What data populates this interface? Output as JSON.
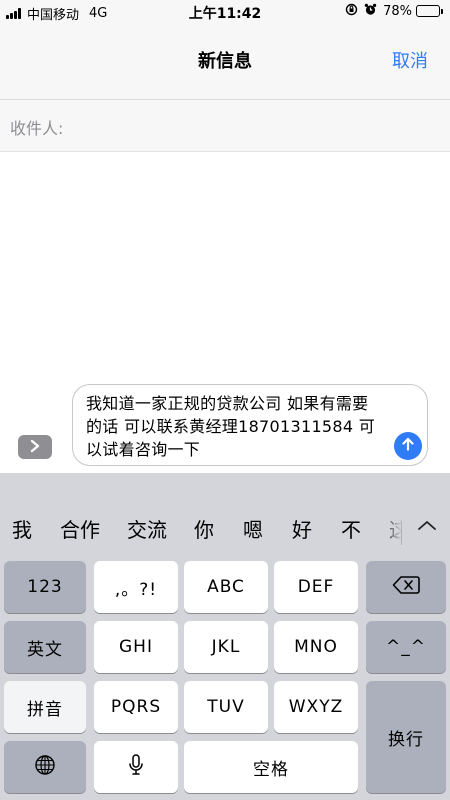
{
  "status_bar": {
    "carrier": "中国移动",
    "network": "4G",
    "time": "上午11:42",
    "battery": "78%",
    "battery_level": 0.78
  },
  "nav": {
    "title": "新信息",
    "cancel_label": "取消"
  },
  "recipient": {
    "label": "收件人:"
  },
  "compose": {
    "text": "我知道一家正规的贷款公司 如果有需要的话 可以联系黄经理18701311584 可以试着咨询一下"
  },
  "keyboard": {
    "candidates": [
      "我",
      "合作",
      "交流",
      "你",
      "嗯",
      "好",
      "不",
      "这"
    ],
    "keys": {
      "numbers": "123",
      "punctuation": ",。?!",
      "abc": "ABC",
      "def": "DEF",
      "english": "英文",
      "ghi": "GHI",
      "jkl": "JKL",
      "mno": "MNO",
      "emoticon": "^_^",
      "pinyin": "拼音",
      "pqrs": "PQRS",
      "tuv": "TUV",
      "wxyz": "WXYZ",
      "return": "换行",
      "space": "空格"
    }
  },
  "colors": {
    "accent": "#2f7cf6",
    "keyboard_bg": "#d3d5db",
    "key_dark": "#abb0bc",
    "key_light": "#ffffff"
  },
  "icons": [
    "signal-bars-icon",
    "orientation-lock-icon",
    "alarm-icon",
    "battery-icon",
    "chevron-right-icon",
    "arrow-up-icon",
    "chevron-up-icon",
    "backspace-icon",
    "globe-icon",
    "microphone-icon"
  ]
}
